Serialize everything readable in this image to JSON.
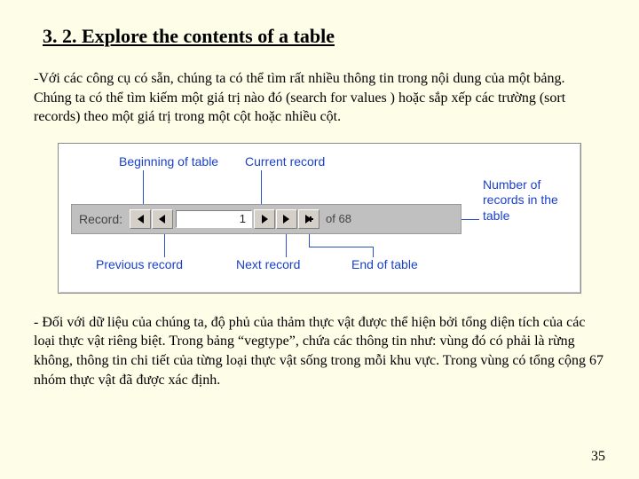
{
  "heading": "3. 2. Explore the contents of a table",
  "para1": "-Với các công cụ có sẵn, chúng ta có thể tìm rất nhiều thông tin trong nội dung của một bảng. Chúng ta có thể tìm kiếm một giá trị nào đó (search for values ) hoặc sắp xếp các trường (sort records) theo một giá trị trong một cột hoặc nhiều cột.",
  "para2": "- Đối với dữ liệu của chúng ta, độ phủ của thảm thực vật được thể hiện bởi tổng diện tích của các loại thực vật riêng biệt. Trong bảng “vegtype”, chứa các thông tin như: vùng đó có phải là rừng không, thông tin chi tiết của từng loại thực vật sống trong mỗi khu vực. Trong vùng có tổng cộng 67 nhóm  thực vật đã được xác định.",
  "page_number": "35",
  "nav": {
    "record_label": "Record:",
    "current_value": "1",
    "of_text": "of 68"
  },
  "labels": {
    "beginning": "Beginning of table",
    "current": "Current record",
    "previous": "Previous record",
    "next": "Next record",
    "end": "End of table",
    "count": "Number of records in the table"
  }
}
